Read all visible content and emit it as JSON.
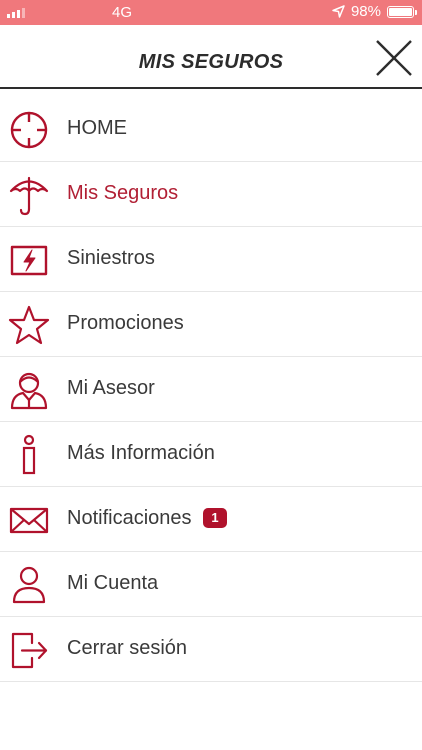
{
  "status_bar": {
    "network": "4G",
    "battery": "98%",
    "battery_level": 0.98
  },
  "header": {
    "title": "MIS SEGUROS",
    "close_icon": "close-icon"
  },
  "menu": {
    "items": [
      {
        "label": "HOME",
        "icon": "home-crosshair-icon"
      },
      {
        "label": "Mis Seguros",
        "icon": "umbrella-icon",
        "active": true
      },
      {
        "label": "Siniestros",
        "icon": "lightning-claim-icon"
      },
      {
        "label": "Promociones",
        "icon": "star-icon"
      },
      {
        "label": "Mi Asesor",
        "icon": "advisor-icon"
      },
      {
        "label": "Más Información",
        "icon": "info-icon"
      },
      {
        "label": "Notificaciones",
        "icon": "envelope-icon",
        "badge": "1"
      },
      {
        "label": "Mi Cuenta",
        "icon": "user-icon"
      },
      {
        "label": "Cerrar sesión",
        "icon": "logout-icon"
      }
    ]
  },
  "colors": {
    "accent": "#b0122c",
    "status_bar": "#f0787c",
    "text": "#3a3a3a"
  }
}
